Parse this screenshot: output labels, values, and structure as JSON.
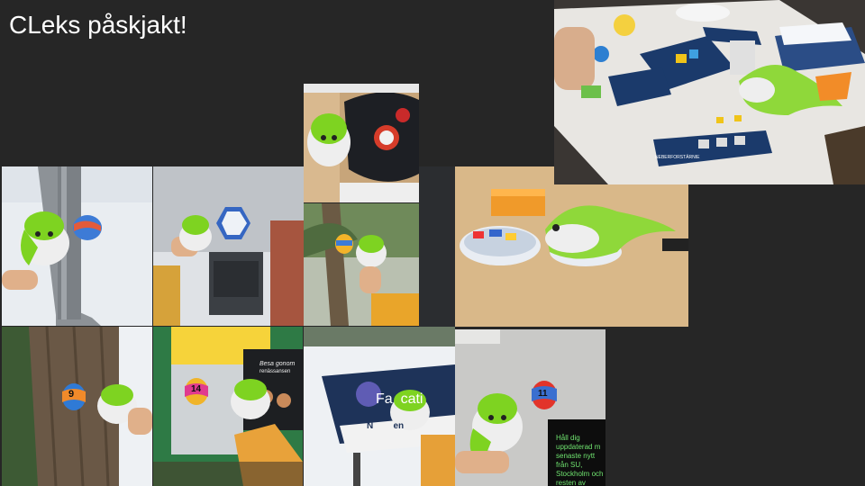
{
  "slide": {
    "title": "CLeks påskjakt!"
  },
  "eggs": {
    "e9": "9",
    "e14": "14",
    "e11": "11"
  },
  "signs": {
    "faculty_line1": "Fa  cati",
    "faculty_line2": "N        en",
    "poster_line1": "Besa gonom",
    "poster_line2": "renässansen",
    "board_title": "NEBERFORSTÄRNIE"
  },
  "info_screen": {
    "line1": "Håll dig",
    "line2": "uppdaterad m",
    "line3": "senaste nytt",
    "line4": "från SU,",
    "line5": "Stockholm och",
    "line6": "resten av"
  },
  "colors": {
    "background": "#262626",
    "plush_green": "#7ed321",
    "snow": "#eef1f4"
  }
}
